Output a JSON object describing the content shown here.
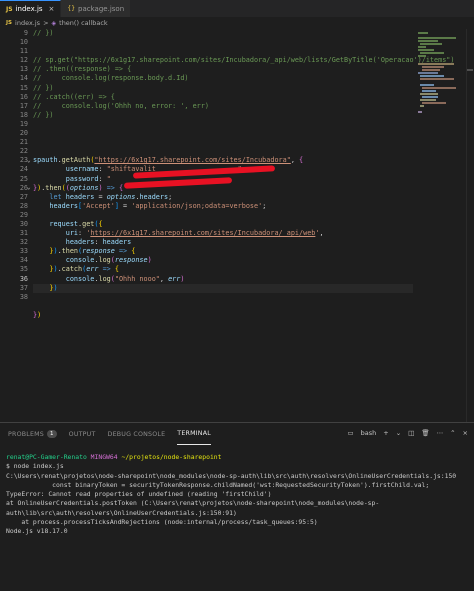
{
  "tabs": [
    {
      "icon": "JS",
      "label": "index.js",
      "active": true,
      "close": "×"
    },
    {
      "icon": "{}",
      "label": "package.json",
      "active": false
    }
  ],
  "breadcrumb": {
    "file": "index.js",
    "sep": ">",
    "symbol": "then() callback"
  },
  "editor": {
    "line_numbers": [
      "9",
      "10",
      "11",
      "12",
      "13",
      "14",
      "15",
      "16",
      "17",
      "18",
      "19",
      "20",
      "21",
      "22",
      "23",
      "24",
      "25",
      "26",
      "27",
      "28",
      "29",
      "30",
      "31",
      "32",
      "33",
      "34",
      "35",
      "36",
      "37",
      "38"
    ],
    "current_line": "36"
  },
  "panel": {
    "tabs": [
      "PROBLEMS",
      "OUTPUT",
      "DEBUG CONSOLE",
      "TERMINAL"
    ],
    "problems_count": "1",
    "active_tab": "TERMINAL",
    "shell": "bash",
    "terminal_lines": [
      {
        "user": "renat@PC-Gamer-Renato",
        "env": "MINGW64",
        "path": "~/projetos/node-sharepoint"
      },
      "$ node index.js",
      "C:\\Users\\renat\\projetos\\node-sharepoint\\node_modules\\node-sp-auth\\lib\\src\\auth\\resolvers\\OnlineUserCredentials.js:150",
      "            const binaryToken = securityTokenResponse.childNamed('wst:RequestedSecurityToken').firstChild.val;",
      "",
      "TypeError: Cannot read properties of undefined (reading 'firstChild')",
      "    at OnlineUserCredentials.postToken (C:\\Users\\renat\\projetos\\node-sharepoint\\node_modules\\node-sp-auth\\lib\\src\\auth\\resolvers\\OnlineUserCredentials.js:150:91)",
      "    at process.processTicksAndRejections (node:internal/process/task_queues:95:5)",
      "",
      "Node.js v18.17.0"
    ]
  }
}
